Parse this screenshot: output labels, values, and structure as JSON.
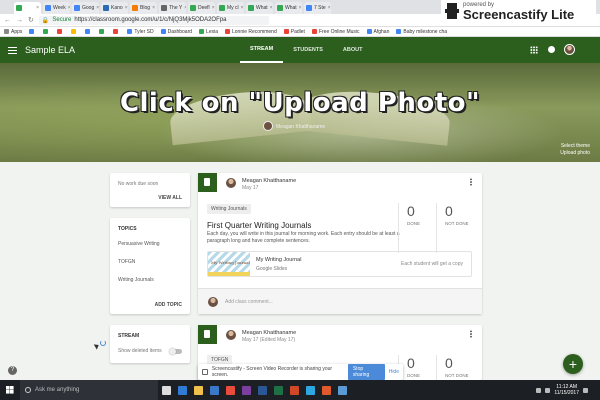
{
  "browser": {
    "tabs": [
      {
        "label": "",
        "color": "#34a853",
        "active": true
      },
      {
        "label": "Week",
        "color": "#4285f4"
      },
      {
        "label": "Goog",
        "color": "#4285f4"
      },
      {
        "label": "Kano",
        "color": "#2b6cb0"
      },
      {
        "label": "Blog",
        "color": "#f57c00"
      },
      {
        "label": "The Y",
        "color": "#666666"
      },
      {
        "label": "Deefl",
        "color": "#34a853"
      },
      {
        "label": "My cl",
        "color": "#34a853"
      },
      {
        "label": "What",
        "color": "#34a853"
      },
      {
        "label": "What",
        "color": "#34a853"
      },
      {
        "label": "7 Ste",
        "color": "#4285f4"
      }
    ],
    "tab_close": "×",
    "secure_label": "Secure",
    "url": "https://classroom.google.com/u/1/c/NjQ3Mjk5ODA2OFpa",
    "bookmarks": [
      {
        "label": "Apps",
        "color": "#888888"
      },
      {
        "label": "",
        "color": "#4285f4"
      },
      {
        "label": "",
        "color": "#34a853"
      },
      {
        "label": "",
        "color": "#ea4335"
      },
      {
        "label": "",
        "color": "#fbbc05"
      },
      {
        "label": "",
        "color": "#4285f4"
      },
      {
        "label": "",
        "color": "#34a853"
      },
      {
        "label": "",
        "color": "#ea4335"
      },
      {
        "label": "Tyler SD",
        "color": "#4285f4"
      },
      {
        "label": "Dashboard",
        "color": "#4285f4"
      },
      {
        "label": "Lexia",
        "color": "#34a853"
      },
      {
        "label": "Lonnie Recommend",
        "color": "#ea4335"
      },
      {
        "label": "Padlet",
        "color": "#ea4335"
      },
      {
        "label": "Free Online Music",
        "color": "#ea4335"
      },
      {
        "label": "Afghan",
        "color": "#4285f4"
      },
      {
        "label": "Baby milestone cha",
        "color": "#4285f4"
      }
    ]
  },
  "screencastify_badge": {
    "small": "powered by",
    "big": "Screencastify Lite"
  },
  "classroom": {
    "title": "Sample ELA",
    "tabs": [
      "STREAM",
      "STUDENTS",
      "ABOUT"
    ],
    "accent": "#2c5f1e",
    "banner": {
      "overlay_text": "Click on \"Upload Photo\"",
      "teacher": "Meagan Khatthaname",
      "select_theme": "Select theme",
      "upload_photo": "Upload photo"
    },
    "upcoming": {
      "text": "No work due soon",
      "view_all": "VIEW ALL"
    },
    "topics": {
      "heading": "TOPICS",
      "items": [
        "Persuasive Writing",
        "TOFGN",
        "Writing Journals"
      ],
      "add_topic": "ADD TOPIC"
    },
    "stream_card": {
      "heading": "STREAM",
      "toggle_label": "Show deleted items"
    },
    "posts": [
      {
        "author": "Meagan Khatthaname",
        "date": "May 17",
        "topic": "Writing Journals",
        "title": "First Quarter Writing Journals",
        "description": "Each day, you will write in this journal for morning work. Each entry should be at least a paragraph long and have complete sentences.",
        "done_count": "0",
        "done_label": "DONE",
        "not_done_count": "0",
        "not_done_label": "NOT DONE",
        "attachment": {
          "thumb_title": "My Writing Journal",
          "title": "My Writing Journal",
          "type": "Google Slides",
          "each_copy": "Each student will get a copy"
        },
        "comment_placeholder": "Add class comment..."
      },
      {
        "author": "Meagan Khatthaname",
        "date": "May 17 (Edited May 17)",
        "topic": "TOFGN",
        "done_count": "0",
        "done_label": "DONE",
        "not_done_count": "0",
        "not_done_label": "NOT DONE"
      }
    ],
    "fab": "+",
    "help": "?"
  },
  "share_bar": {
    "text": "Screencastify - Screen Video Recorder is sharing your screen.",
    "stop": "Stop sharing",
    "hide": "Hide"
  },
  "taskbar": {
    "search_placeholder": "Ask me anything",
    "apps": [
      {
        "name": "task-view",
        "color": "#dddddd"
      },
      {
        "name": "edge",
        "color": "#2f7bd6"
      },
      {
        "name": "explorer",
        "color": "#f0c24b"
      },
      {
        "name": "store",
        "color": "#3a78c9"
      },
      {
        "name": "chrome",
        "color": "#e94b3c"
      },
      {
        "name": "onenote",
        "color": "#7b3fa0"
      },
      {
        "name": "word",
        "color": "#2b5797"
      },
      {
        "name": "excel",
        "color": "#1e7145"
      },
      {
        "name": "powerpoint",
        "color": "#d24726"
      },
      {
        "name": "app",
        "color": "#2ca7e0"
      },
      {
        "name": "app",
        "color": "#e05a2c"
      },
      {
        "name": "app",
        "color": "#5b9bd5"
      }
    ],
    "time": "11:12 AM",
    "date": "11/15/2017"
  }
}
